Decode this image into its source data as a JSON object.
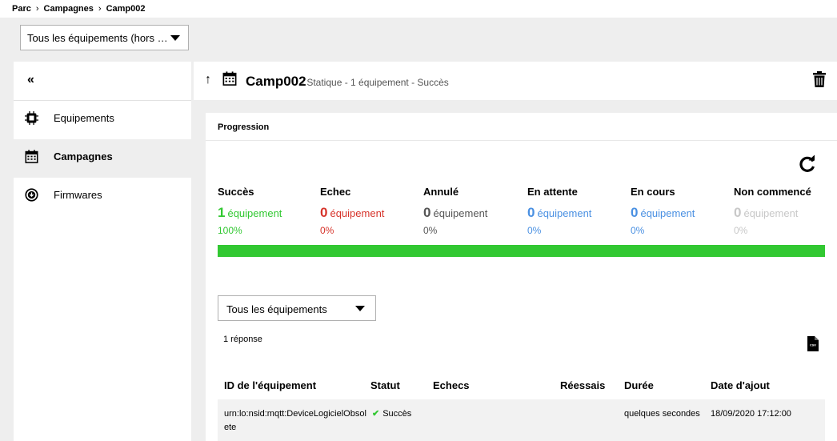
{
  "breadcrumb": {
    "items": [
      "Parc",
      "Campagnes",
      "Camp002"
    ],
    "separator": "›"
  },
  "top_filter": {
    "value": "Tous les équipements (hors …"
  },
  "sidebar": {
    "collapse_label": "«",
    "items": [
      {
        "label": "Equipements",
        "icon": "chip-icon",
        "active": false
      },
      {
        "label": "Campagnes",
        "icon": "calendar-icon",
        "active": true
      },
      {
        "label": "Firmwares",
        "icon": "download-circle-icon",
        "active": false
      }
    ]
  },
  "header": {
    "up_icon": "↑",
    "title": "Camp002",
    "subtitle": "- Statique - 1 équipement - Succès"
  },
  "progression": {
    "title": "Progression",
    "stats": [
      {
        "label": "Succès",
        "count": "1",
        "unit": "équipement",
        "pct": "100%",
        "color": "#32c832"
      },
      {
        "label": "Echec",
        "count": "0",
        "unit": "équipement",
        "pct": "0%",
        "color": "#d6332a"
      },
      {
        "label": "Annulé",
        "count": "0",
        "unit": "équipement",
        "pct": "0%",
        "color": "#555555"
      },
      {
        "label": "En attente",
        "count": "0",
        "unit": "équipement",
        "pct": "0%",
        "color": "#4a90e2"
      },
      {
        "label": "En cours",
        "count": "0",
        "unit": "équipement",
        "pct": "0%",
        "color": "#4a90e2"
      },
      {
        "label": "Non commencé",
        "count": "0",
        "unit": "équipement",
        "pct": "0%",
        "color": "#c8c8c8"
      }
    ],
    "success_fraction": 1.0
  },
  "table_filter": {
    "value": "Tous les équipements"
  },
  "results": {
    "count_label": "1 réponse"
  },
  "table": {
    "columns": [
      "ID de l'équipement",
      "Statut",
      "Echecs",
      "Réessais",
      "Durée",
      "Date d'ajout"
    ],
    "rows": [
      {
        "id": "urn:lo:nsid:mqtt:DeviceLogicielObsolete",
        "status": "Succès",
        "echecs": "",
        "reessais": "",
        "duree": "quelques secondes",
        "date": "18/09/2020 17:12:00"
      }
    ]
  },
  "colors": {
    "success": "#32c832",
    "error": "#d6332a",
    "info": "#4a90e2",
    "muted": "#c8c8c8"
  }
}
